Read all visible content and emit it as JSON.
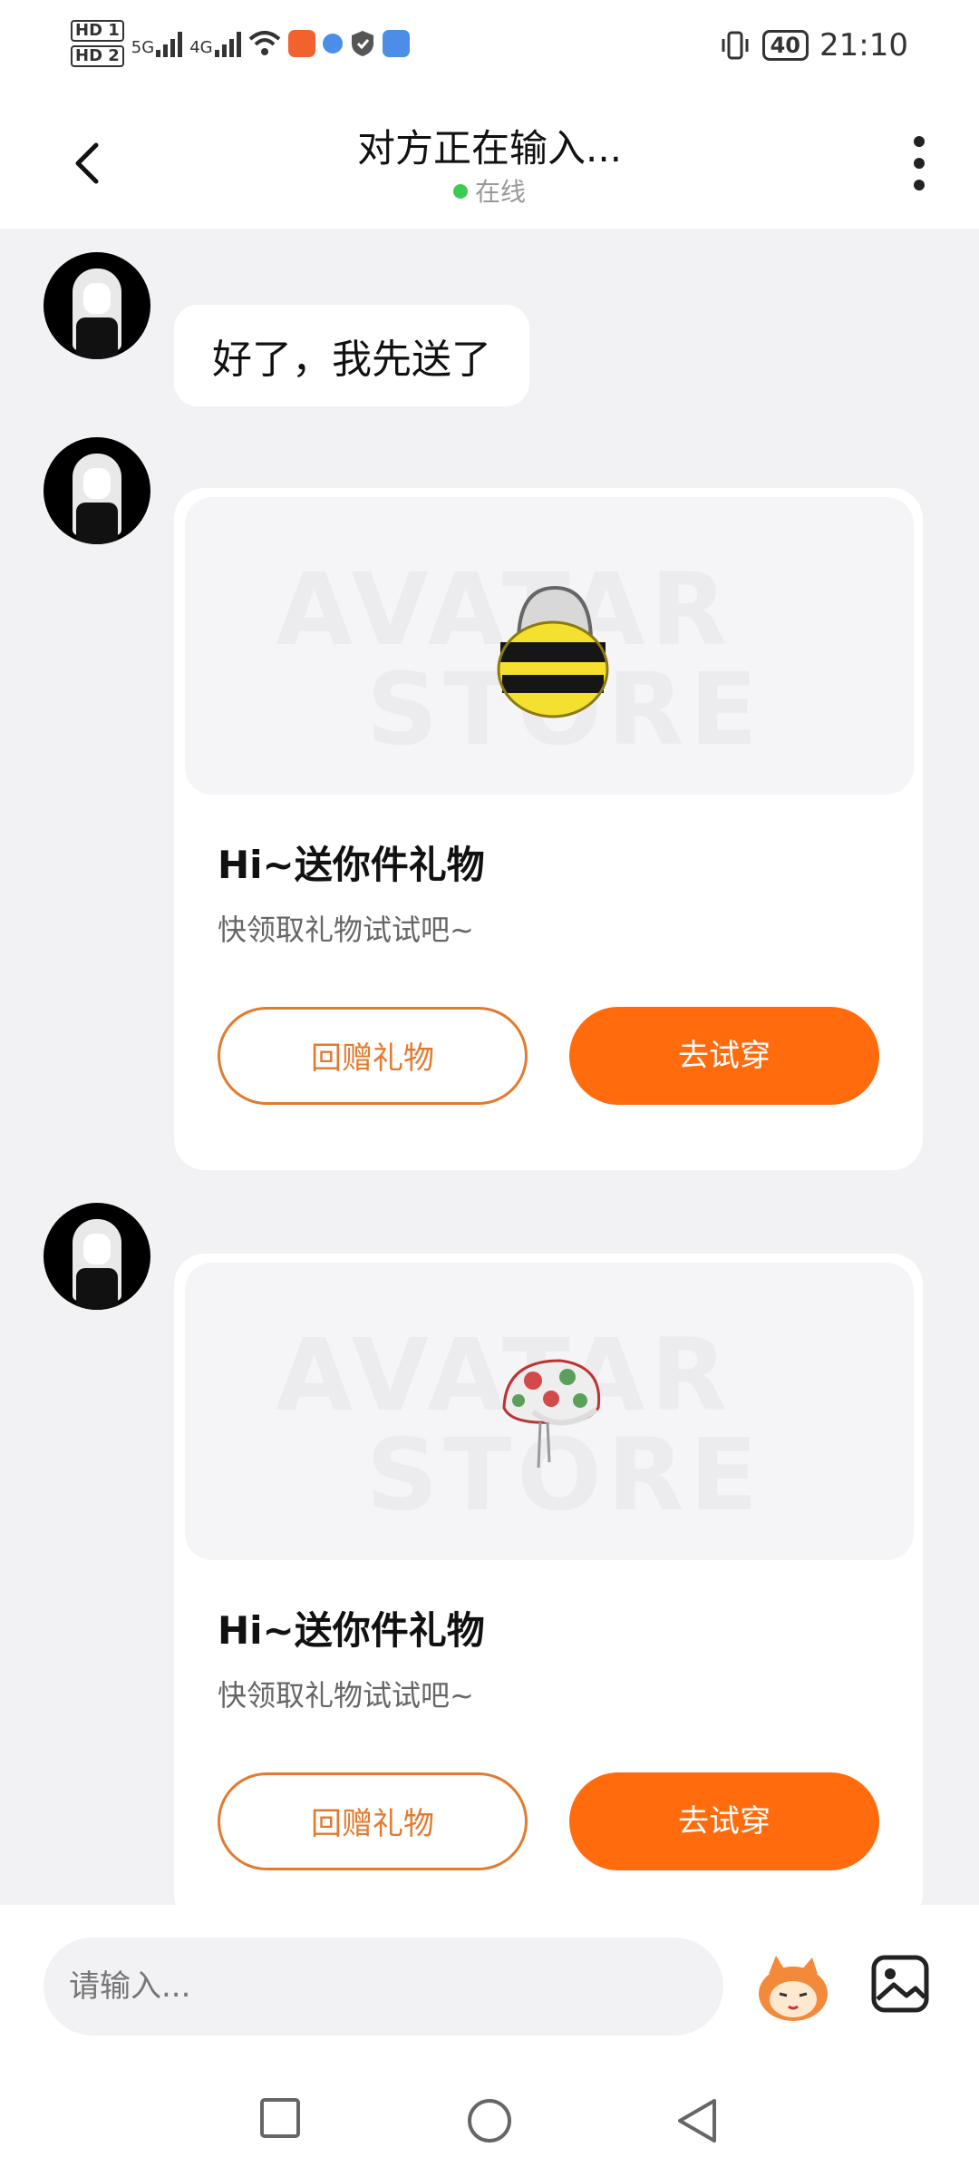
{
  "status_bar": {
    "hd1": "HD 1",
    "hd2": "HD 2",
    "net1": "5G",
    "net2": "4G",
    "battery": "40",
    "time": "21:10"
  },
  "header": {
    "title": "对方正在输入...",
    "status": "在线"
  },
  "messages": [
    {
      "type": "text",
      "text": "好了，我先送了"
    },
    {
      "type": "gift",
      "title": "Hi~送你件礼物",
      "subtitle": "快领取礼物试试吧~",
      "btn_return": "回赠礼物",
      "btn_try": "去试穿",
      "watermark1": "AVATAR",
      "watermark2": "STORE",
      "item": "bee-costume"
    },
    {
      "type": "gift",
      "title": "Hi~送你件礼物",
      "subtitle": "快领取礼物试试吧~",
      "btn_return": "回赠礼物",
      "btn_try": "去试穿",
      "watermark1": "AVATAR",
      "watermark2": "STORE",
      "item": "floral-hat"
    }
  ],
  "input": {
    "placeholder": "请输入..."
  },
  "colors": {
    "accent": "#ff6b0d",
    "online": "#3ecb52"
  }
}
